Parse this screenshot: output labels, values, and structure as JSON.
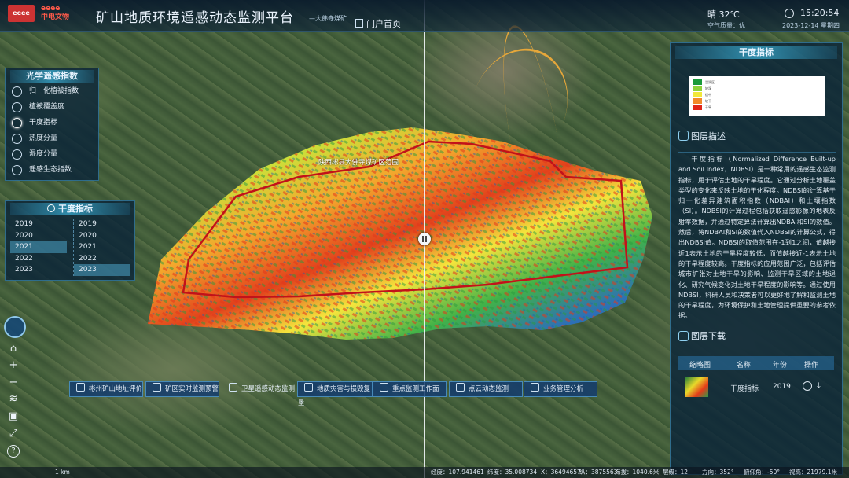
{
  "header": {
    "logo_text": "eeee",
    "brand_text": "中电文物",
    "title": "矿山地质环境遥感动态监测平台",
    "subtitle": "—大佛寺煤矿",
    "portal_link": "门户首页",
    "weather": "晴 32℃",
    "air_quality": "空气质量：优",
    "time": "15:20:54",
    "date": "2023-12-14 星期四"
  },
  "left_panel": {
    "title": "光学遥感指数",
    "items": [
      {
        "label": "归一化植被指数",
        "icon": "leaf-icon"
      },
      {
        "label": "植被覆盖度",
        "icon": "tree-icon"
      },
      {
        "label": "干度指标",
        "icon": "sun-icon",
        "active": true
      },
      {
        "label": "热度分量",
        "icon": "thermometer-icon"
      },
      {
        "label": "湿度分量",
        "icon": "droplet-icon"
      },
      {
        "label": "遥感生态指数",
        "icon": "eco-icon"
      }
    ]
  },
  "year_panel": {
    "title": "干度指标",
    "left_years": [
      "2019",
      "2020",
      "2021",
      "2022",
      "2023"
    ],
    "right_years": [
      "2019",
      "2020",
      "2021",
      "2022",
      "2023"
    ],
    "left_selected": "2021",
    "right_selected": "2023"
  },
  "map": {
    "area_label": "陕西彬县大佛寺煤矿区范围"
  },
  "right_panel": {
    "title": "干度指标",
    "legend": [
      {
        "label": "湿润区",
        "color": "#1a9a3a"
      },
      {
        "label": "较湿",
        "color": "#8ed23a"
      },
      {
        "label": "适中",
        "color": "#f2e83a"
      },
      {
        "label": "较干",
        "color": "#f28a2a"
      },
      {
        "label": "干旱",
        "color": "#e0261a"
      }
    ],
    "desc_title": "图层描述",
    "description": "干度指标（Normalized Difference Built-up and Soil Index，NDBSI）是一种常用的遥感生态监测指标，用于评估土地的干旱程度。它通过分析土地覆盖类型的变化来反映土地的干化程度。NDBSI的计算基于归一化差异建筑面积指数（NDBAI）和土壤指数（SI）。NDBSI的计算过程包括获取遥感影像的地表反射率数据，并通过特定算法计算出NDBAI和SI的数值。然后，将NDBAI和SI的数值代入NDBSI的计算公式，得出NDBSI值。NDBSI的取值范围在-1到1之间，值越接近1表示土地的干旱程度较低，而值越接近-1表示土地的干旱程度较高。干度指标的应用范围广泛，包括评估城市扩张对土地干旱的影响、监测干旱区域的土地退化、研究气候变化对土地干旱程度的影响等。通过使用NDBSI，科研人员和决策者可以更好地了解和监测土地的干旱程度，为环境保护和土地管理提供重要的参考依据。",
    "download_title": "图层下载",
    "table_headers": [
      "缩略图",
      "名称",
      "年份",
      "操作"
    ],
    "rows": [
      {
        "name": "干度指标",
        "year": "2019"
      }
    ]
  },
  "bottom_nav": [
    "彬州矿山地址评价",
    "矿区实时监测预警",
    "卫星遥感动态监测",
    "地质灾害与损毁复垦",
    "重点监测工作面",
    "点云动态监测",
    "业务管理分析"
  ],
  "status_bar": {
    "longitude": "经度：107.941461",
    "latitude": "纬度：35.008734",
    "x": "X：36494657",
    "y": "纵：3875563",
    "altitude": "海拔：1040.6米",
    "level": "层级：12",
    "heading": "方向：352°",
    "pitch": "俯仰角：-50°",
    "height": "视高：21979.1米",
    "scale": "1 km"
  }
}
